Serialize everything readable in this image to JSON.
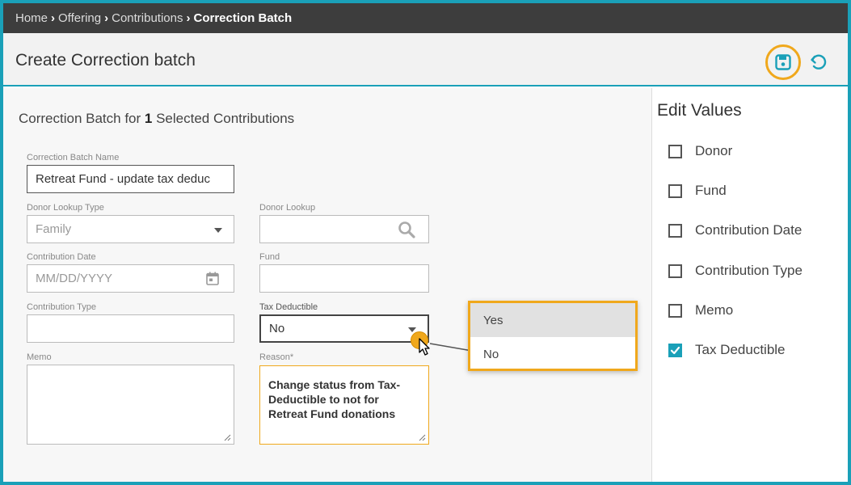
{
  "breadcrumb": {
    "items": [
      "Home",
      "Offering",
      "Contributions"
    ],
    "current": "Correction Batch"
  },
  "header": {
    "title": "Create Correction batch",
    "save_icon": "floppy-disk-icon",
    "undo_icon": "undo-icon"
  },
  "form": {
    "subtitle_prefix": "Correction Batch for ",
    "selected_count": "1",
    "subtitle_suffix": " Selected Contributions",
    "batch_name_label": "Correction Batch Name",
    "batch_name_value": "Retreat Fund - update tax deduc",
    "donor_lookup_type_label": "Donor Lookup Type",
    "donor_lookup_type_value": "Family",
    "donor_lookup_label": "Donor Lookup",
    "contribution_date_label": "Contribution Date",
    "contribution_date_placeholder": "MM/DD/YYYY",
    "fund_label": "Fund",
    "contribution_type_label": "Contribution Type",
    "tax_deductible_label": "Tax Deductible",
    "tax_deductible_value": "No",
    "memo_label": "Memo",
    "reason_label": "Reason*",
    "reason_value": "Change status from Tax-Deductible to not for Retreat Fund donations"
  },
  "dropdown": {
    "options": [
      "Yes",
      "No"
    ],
    "highlighted": "Yes"
  },
  "edit_values": {
    "title": "Edit Values",
    "items": [
      {
        "label": "Donor",
        "checked": false
      },
      {
        "label": "Fund",
        "checked": false
      },
      {
        "label": "Contribution Date",
        "checked": false
      },
      {
        "label": "Contribution Type",
        "checked": false
      },
      {
        "label": "Memo",
        "checked": false
      },
      {
        "label": "Tax Deductible",
        "checked": true
      }
    ]
  },
  "colors": {
    "accent": "#1aa0b8",
    "highlight": "#f0a81c",
    "breadcrumb_bg": "#3d3d3d"
  }
}
